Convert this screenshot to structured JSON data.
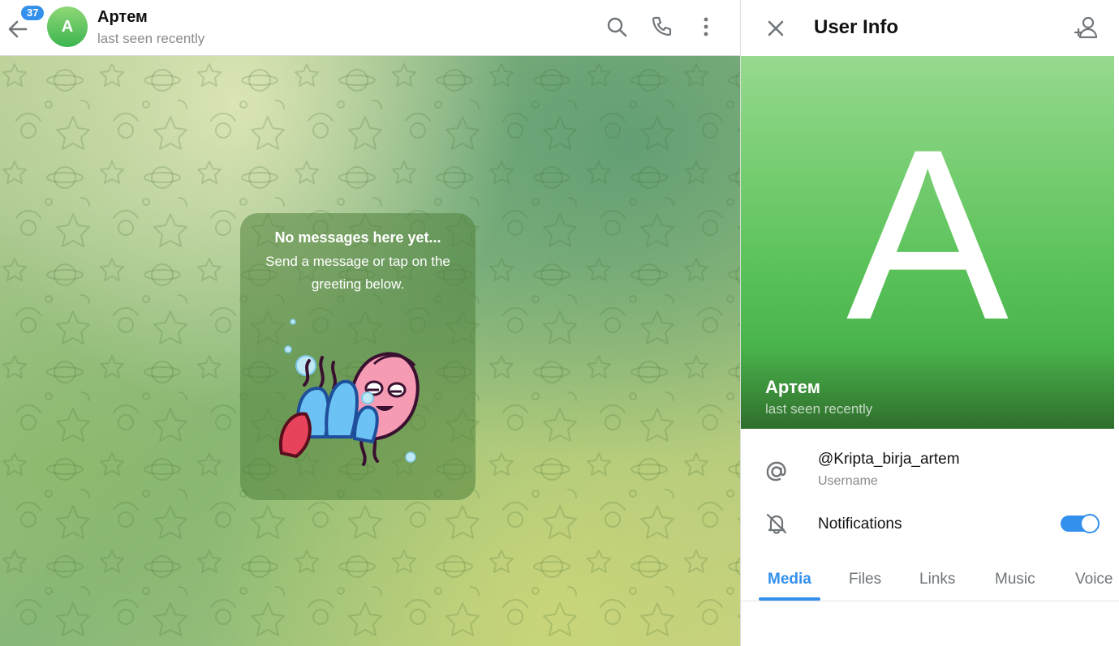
{
  "chat": {
    "unread_count": "37",
    "avatar_letter": "A",
    "name": "Артем",
    "status": "last seen recently",
    "empty": {
      "title": "No messages here yet...",
      "text": "Send a message or tap on the greeting below."
    }
  },
  "info": {
    "title": "User Info",
    "avatar_letter": "A",
    "name": "Артем",
    "status": "last seen recently",
    "username_value": "@Kripta_birja_artem",
    "username_label": "Username",
    "notifications_label": "Notifications",
    "notifications_enabled": true,
    "tabs": [
      "Media",
      "Files",
      "Links",
      "Music",
      "Voice"
    ],
    "active_tab": "Media"
  },
  "icons": {
    "back": "arrow-left-icon",
    "search": "search-icon",
    "call": "phone-icon",
    "more": "more-vertical-icon",
    "close": "close-icon",
    "add_contact": "add-user-icon",
    "username": "at-icon",
    "notifications": "bell-off-icon"
  },
  "colors": {
    "accent": "#3390ec",
    "avatar_green": "#4ab44c",
    "text_secondary": "#8a8a8a"
  }
}
